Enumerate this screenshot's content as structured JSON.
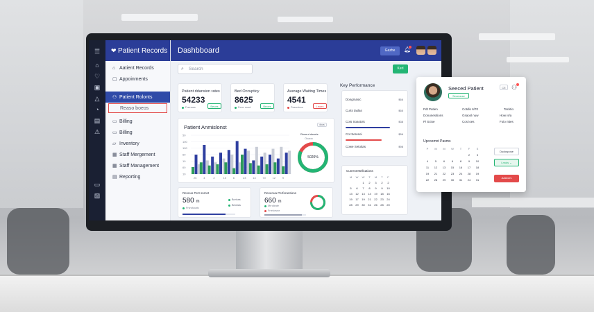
{
  "app": {
    "name": "Patient Records",
    "page_title": "Dashbboard",
    "topbar_button": "Gazhe",
    "sidebar_icons": [
      "menu-icon",
      "home-icon",
      "heart-icon",
      "folder-icon",
      "bell-icon",
      "cart-icon",
      "building-icon",
      "warning-icon",
      "archive-icon",
      "terminal-icon"
    ]
  },
  "nav": {
    "items": [
      {
        "icon": "home-icon",
        "label": "Aatient Records"
      },
      {
        "icon": "calendar-icon",
        "label": "Appoinments"
      },
      {
        "icon": "person-icon",
        "label": "Patient Rolonts",
        "active": true
      },
      {
        "icon": "",
        "label": "Reaso boeos",
        "boxed": true
      },
      {
        "icon": "receipt-icon",
        "label": "Billing"
      },
      {
        "icon": "receipt-icon",
        "label": "Billing"
      },
      {
        "icon": "box-icon",
        "label": "Inventory"
      },
      {
        "icon": "grid-icon",
        "label": "Staff Mergement"
      },
      {
        "icon": "grid-icon",
        "label": "Staff Management"
      },
      {
        "icon": "report-icon",
        "label": "Reporting"
      }
    ]
  },
  "search": {
    "placeholder": "Search"
  },
  "action_button": "Kerl",
  "stats": [
    {
      "label": "Patient ddansion rates",
      "value": "54233",
      "sub": "Foenaes",
      "pill": "Beoes",
      "color": "#23b574"
    },
    {
      "label": "Bed Occupticy",
      "value": "8625",
      "sub": "Feoe rnaot",
      "pill": "Beoes",
      "color": "#23b574"
    },
    {
      "label": "Average Waiting Times",
      "value": "4541",
      "sub": "Pasunions",
      "pill": "Leoes",
      "color": "#e34a4a"
    }
  ],
  "admissions": {
    "title": "Patient Anmislonst",
    "button": "doas",
    "donut_caption": "Reseut dosets",
    "donut_sub": "Ocaoo",
    "donut_value": "5020%"
  },
  "chart_data": {
    "type": "bar",
    "title": "Patient Anmislonst",
    "categories": [
      "Jan",
      "Feb",
      "Mar",
      "Apr",
      "May",
      "Jun",
      "Jul",
      "Aug",
      "Sep",
      "Oct",
      "Nov",
      "Dec"
    ],
    "yticks": [
      "50",
      "100",
      "100",
      "60",
      "10",
      "60",
      "10"
    ],
    "xticks": [
      "2h",
      "4",
      "2",
      "10",
      "6",
      "23",
      "13",
      "70",
      "12",
      "9"
    ],
    "series": [
      {
        "color": "#2d9c5a",
        "values": [
          18,
          30,
          22,
          25,
          30,
          15,
          50,
          28,
          22,
          25,
          30,
          20
        ]
      },
      {
        "color": "#2f3fa0",
        "values": [
          50,
          75,
          45,
          55,
          62,
          85,
          65,
          35,
          45,
          50,
          40,
          55
        ]
      },
      {
        "color": "#c8ccd6",
        "values": [
          25,
          35,
          30,
          40,
          50,
          30,
          60,
          70,
          55,
          65,
          70,
          60
        ]
      }
    ],
    "donut": {
      "percent": 82,
      "colors": [
        "#23b574",
        "#e34a4a"
      ]
    }
  },
  "revenue": [
    {
      "title": "Revnus Pert snmnt",
      "value": "580",
      "unit": "m",
      "sub": "Frsndvcats",
      "legend": [
        "Boricas",
        "Beobas"
      ],
      "bar_progress": 0.82,
      "bar_color": "#2f3fa0"
    },
    {
      "title": "Revenua Perforantions",
      "value": "660",
      "unit": "m",
      "sub": "Frrelorsne",
      "legend": [
        "Mrrolirate",
        "Frrelorsne"
      ],
      "bar_progress": 0.9,
      "bar_color": "#9aa0b3"
    }
  ],
  "revenue_ring": {
    "percent": 75,
    "colors": [
      "#23b574",
      "#e34a4a"
    ]
  },
  "key_performance": {
    "title": "Key Performance",
    "rows": [
      {
        "label": "Dongmasic",
        "value": "$66"
      },
      {
        "label": "Curts taslas",
        "value": "$55"
      },
      {
        "label": "Cots Soastois",
        "value": "$38"
      },
      {
        "label": "Cot Seresoi",
        "value": "$56"
      },
      {
        "label": "Cowe Setoitas",
        "value": "$98"
      }
    ],
    "bars": [
      {
        "progress": 0.8,
        "color": "#2f3fa0"
      },
      {
        "progress": 0.65,
        "color": "#e34a4a"
      }
    ]
  },
  "calendar_main": {
    "title": "Current Mellcations",
    "headers": [
      "M",
      "W",
      "W",
      "T",
      "M",
      "T",
      "F"
    ],
    "days": [
      "",
      "",
      "1",
      "2",
      "3",
      "2",
      "2",
      "5",
      "6",
      "7",
      "8",
      "9",
      "9",
      "10",
      "13",
      "12",
      "13",
      "14",
      "19",
      "18",
      "16",
      "19",
      "17",
      "19",
      "21",
      "22",
      "23",
      "24",
      "28",
      "29",
      "30",
      "31",
      "26",
      "28",
      "20"
    ]
  },
  "panel": {
    "name": "Seeced Patient",
    "badge": "Seceouse",
    "button": "CE",
    "rows": [
      [
        "Pdt Patien",
        "Cotdlo 6/70",
        "Tacktio"
      ],
      [
        "Donunesitions",
        "Gsaosl nuw",
        "How is/a"
      ],
      [
        "Pi Scioe",
        "Cos ioes",
        "Foio nttes"
      ]
    ],
    "calendar_title": "Upcoomnt Pasms",
    "headers": [
      "P",
      "M",
      "M",
      "W",
      "T",
      "F",
      "S"
    ],
    "days": [
      "",
      "",
      "",
      "",
      "",
      "2",
      "3",
      "4",
      "5",
      "6",
      "6",
      "8",
      "9",
      "10",
      "11",
      "12",
      "13",
      "15",
      "16",
      "17",
      "18",
      "19",
      "21",
      "22",
      "23",
      "24",
      "28",
      "19",
      "22",
      "28",
      "29",
      "30",
      "31",
      "24",
      "31"
    ],
    "side_buttons": [
      "Duckspose",
      "Lmois",
      "Aasbors"
    ]
  }
}
